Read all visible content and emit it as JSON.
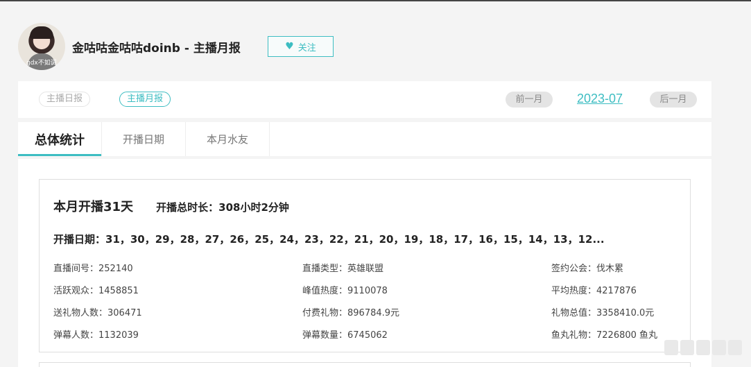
{
  "header": {
    "avatar_text": "gdx不如调",
    "title": "金咕咕金咕咕doinb - 主播月报",
    "follow_label": "关注",
    "follow_icon": "heart-icon"
  },
  "report_type": {
    "daily_label": "主播日报",
    "monthly_label": "主播月报",
    "prev_month_label": "前一月",
    "current_month": "2023-07",
    "next_month_label": "后一月"
  },
  "tabs": [
    {
      "label": "总体统计",
      "active": true
    },
    {
      "label": "开播日期",
      "active": false
    },
    {
      "label": "本月水友",
      "active": false
    }
  ],
  "summary": {
    "days_text": "本月开播31天",
    "duration_text": "开播总时长：308小时2分钟",
    "dates_text": "开播日期：31，30，29，28，27，26，25，24，23，22，21，20，19，18，17，16，15，14，13，12..."
  },
  "stats": {
    "room_id": "直播间号：252140",
    "live_type": "直播类型：英雄联盟",
    "guild": "签约公会：伐木累",
    "active_viewers": "活跃观众：1458851",
    "peak_heat": "峰值热度：9110078",
    "avg_heat": "平均热度：4217876",
    "gift_senders": "送礼物人数：306471",
    "paid_gifts": "付费礼物：896784.9元",
    "gift_total": "礼物总值：3358410.0元",
    "danmu_users": "弹幕人数：1132039",
    "danmu_count": "弹幕数量：6745062",
    "fishball_gifts": "鱼丸礼物：7226800 鱼丸"
  },
  "colors": {
    "accent": "#3dbdc2",
    "background": "#f4f4f4"
  }
}
